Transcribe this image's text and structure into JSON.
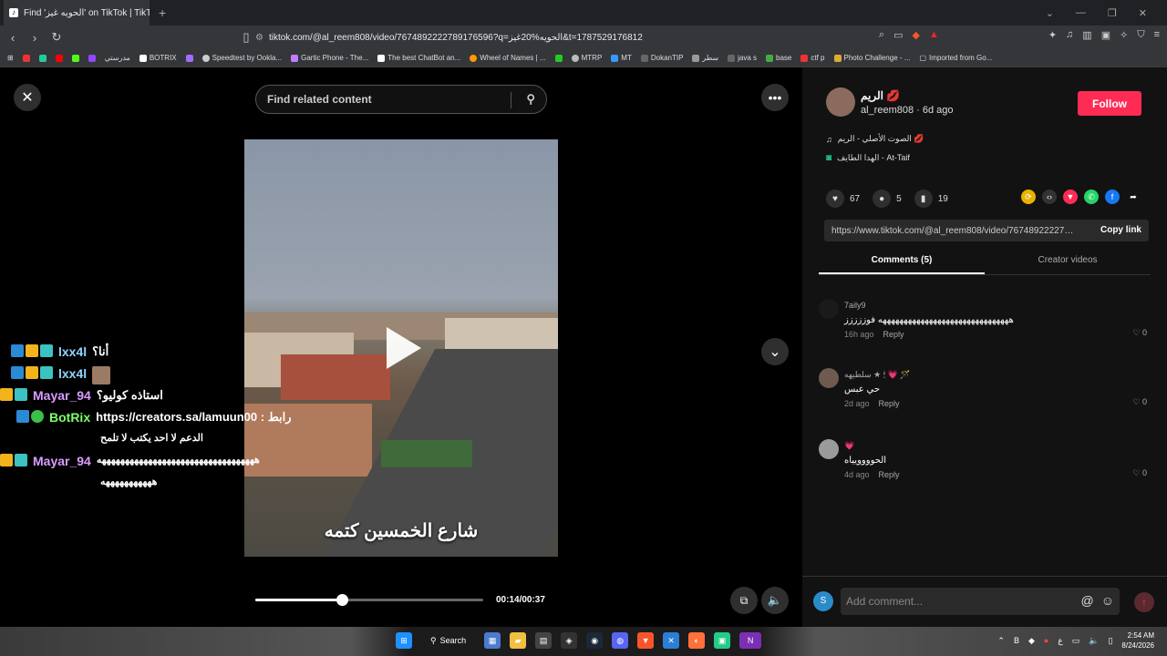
{
  "browser": {
    "tab_title": "Find 'الحويه غيز' on TikTok | TikTok",
    "url": "tiktok.com/@al_reem808/video/7674892222789176596?q=الحويه%20غيز&t=1787529176812",
    "new_tab": "+"
  },
  "bookmarks": [
    "مدرستي",
    "BOTRIX",
    "Speedtest by Ookla...",
    "Gartic Phone - The...",
    "The best ChatBot an...",
    "Wheel of Names | ...",
    "MTRP",
    "MT",
    "DokanTIP",
    "سطر",
    "java s",
    "base",
    "ctf p",
    "Photo Challenge - ...",
    "Imported from Go..."
  ],
  "player": {
    "search_placeholder": "Find related content",
    "caption": "شارع الخمسين كتمه",
    "time": "00:14/00:37",
    "progress": 0.38,
    "icons": {
      "close": "close-icon",
      "more": "more-icon",
      "down": "chevron-down-icon",
      "play": "play-icon",
      "mute": "volume-icon",
      "pip": "pip-icon",
      "search": "search-icon"
    }
  },
  "chat": [
    {
      "user": "lxx4l",
      "user_color": "#8fd3ff",
      "text": "أنا؟"
    },
    {
      "user": "lxx4l",
      "user_color": "#8fd3ff",
      "text": ""
    },
    {
      "user": "Mayar_94",
      "user_color": "#d99cff",
      "text": "استاذه كوليو؟"
    },
    {
      "user": "BotRix",
      "user_color": "#7dff6a",
      "text": "https://creators.sa/lamuun00 : رابط",
      "text2": "الدعم لا احد يكتب لا تلمح"
    },
    {
      "user": "Mayar_94",
      "user_color": "#d99cff",
      "text": "ههههههههههههههههههههههههههههههههههه",
      "text2": "هههههههههههه"
    }
  ],
  "creator": {
    "name": "الريم 💋",
    "handle": "al_reem808 · 6d ago",
    "follow": "Follow",
    "music": "الصوت الأصلي - الريم 💋",
    "location": "الهدا الطايف - At-Taif"
  },
  "stats": {
    "likes": "67",
    "comments": "5",
    "saves": "19"
  },
  "link": {
    "url": "https://www.tiktok.com/@al_reem808/video/7674892222789176596",
    "copy": "Copy link"
  },
  "tabs": {
    "comments": "Comments (5)",
    "creator": "Creator videos"
  },
  "comments": [
    {
      "name": "7aily9",
      "text": "هههههههههههههههههههههههههههههههه فوززززز",
      "time": "16h ago",
      "reply": "Reply",
      "likes": "0",
      "color": "#1a1a1a"
    },
    {
      "name": "سلطيهه ★ 🕯 💗 🪄",
      "text": "حي عبس",
      "time": "2d ago",
      "reply": "Reply",
      "likes": "0",
      "color": "#6e5a4e"
    },
    {
      "name": "💗",
      "text": "الحوووويياه",
      "time": "4d ago",
      "reply": "Reply",
      "likes": "0",
      "color": "#9a9a9a"
    }
  ],
  "comment_bar": {
    "placeholder": "Add comment...",
    "avatar": "S"
  },
  "taskbar": {
    "search": "Search",
    "time": "2:54 AM",
    "date": "8/24/2026",
    "lang": "ع"
  }
}
